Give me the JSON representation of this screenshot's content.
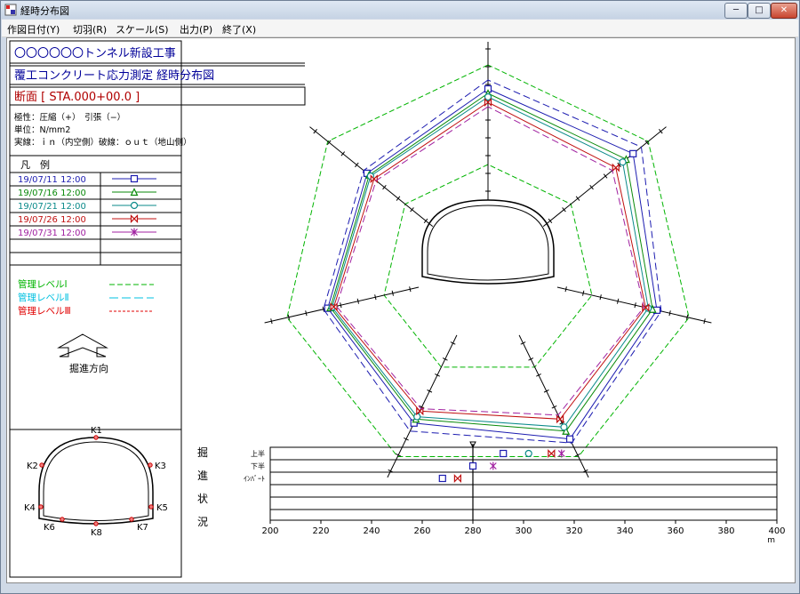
{
  "window": {
    "title": "経時分布図",
    "min_label": "─",
    "max_label": "□",
    "close_label": "✕"
  },
  "menu": [
    "作図日付(Y)",
    "切羽(R)",
    "スケール(S)",
    "出力(P)",
    "終了(X)"
  ],
  "header": {
    "project": "〇〇〇〇〇〇トンネル新設工事",
    "subtitle": "覆工コンクリート応力測定 経時分布図",
    "section": "断面 [ STA.000+00.0 ]"
  },
  "info": {
    "polarity": "極性：圧縮（+）　引張（−）",
    "unit": "単位：N/mm2",
    "lines": "実線：ｉｎ（内空側）破線：ｏｕｔ（地山側）"
  },
  "legend": {
    "title": "凡　例",
    "entries": [
      {
        "date": "19/07/11 12:00",
        "color": "#1c1cb0",
        "marker": "square"
      },
      {
        "date": "19/07/16 12:00",
        "color": "#0a8a0a",
        "marker": "triangle"
      },
      {
        "date": "19/07/21 12:00",
        "color": "#0a8a8a",
        "marker": "circle"
      },
      {
        "date": "19/07/26 12:00",
        "color": "#c01010",
        "marker": "bowtie"
      },
      {
        "date": "19/07/31 12:00",
        "color": "#a020a0",
        "marker": "star"
      }
    ]
  },
  "levels": [
    {
      "label": "管理レベルⅠ",
      "color": "#00b400",
      "dash": "6,3"
    },
    {
      "label": "管理レベルⅡ",
      "color": "#00c0e0",
      "dash": "10,4"
    },
    {
      "label": "管理レベルⅢ",
      "color": "#e00000",
      "dash": "3,2"
    }
  ],
  "direction_label": "掘進方向",
  "section_points": [
    "K1",
    "K2",
    "K3",
    "K4",
    "K5",
    "K6",
    "K8",
    "K7"
  ],
  "progress": {
    "side_label": [
      "掘",
      "進",
      "状",
      "況"
    ],
    "row_labels": [
      "上半",
      "下半",
      "ｲﾝﾊﾞｰﾄ"
    ],
    "x_ticks": [
      "200",
      "220",
      "240",
      "260",
      "280",
      "300",
      "320",
      "340",
      "360",
      "380",
      "400"
    ],
    "x_unit": "m",
    "current_position": 280
  },
  "chart_data": {
    "type": "scatter",
    "xlim": [
      200,
      400
    ],
    "series": [
      {
        "name": "19/07/11 12:00",
        "color": "#1c1cb0",
        "marker": "square",
        "points": [
          [
            292,
            "上半"
          ],
          [
            280,
            "下半"
          ],
          [
            268,
            "ｲﾝﾊﾞｰﾄ"
          ]
        ]
      },
      {
        "name": "19/07/21 12:00",
        "color": "#0a8a8a",
        "marker": "circle",
        "points": [
          [
            302,
            "上半"
          ]
        ]
      },
      {
        "name": "19/07/26 12:00",
        "color": "#c01010",
        "marker": "bowtie",
        "points": [
          [
            311,
            "上半"
          ],
          [
            274,
            "ｲﾝﾊﾞｰﾄ"
          ]
        ]
      },
      {
        "name": "19/07/31 12:00",
        "color": "#a020a0",
        "marker": "star",
        "points": [
          [
            315,
            "上半"
          ],
          [
            288,
            "下半"
          ]
        ]
      }
    ]
  }
}
